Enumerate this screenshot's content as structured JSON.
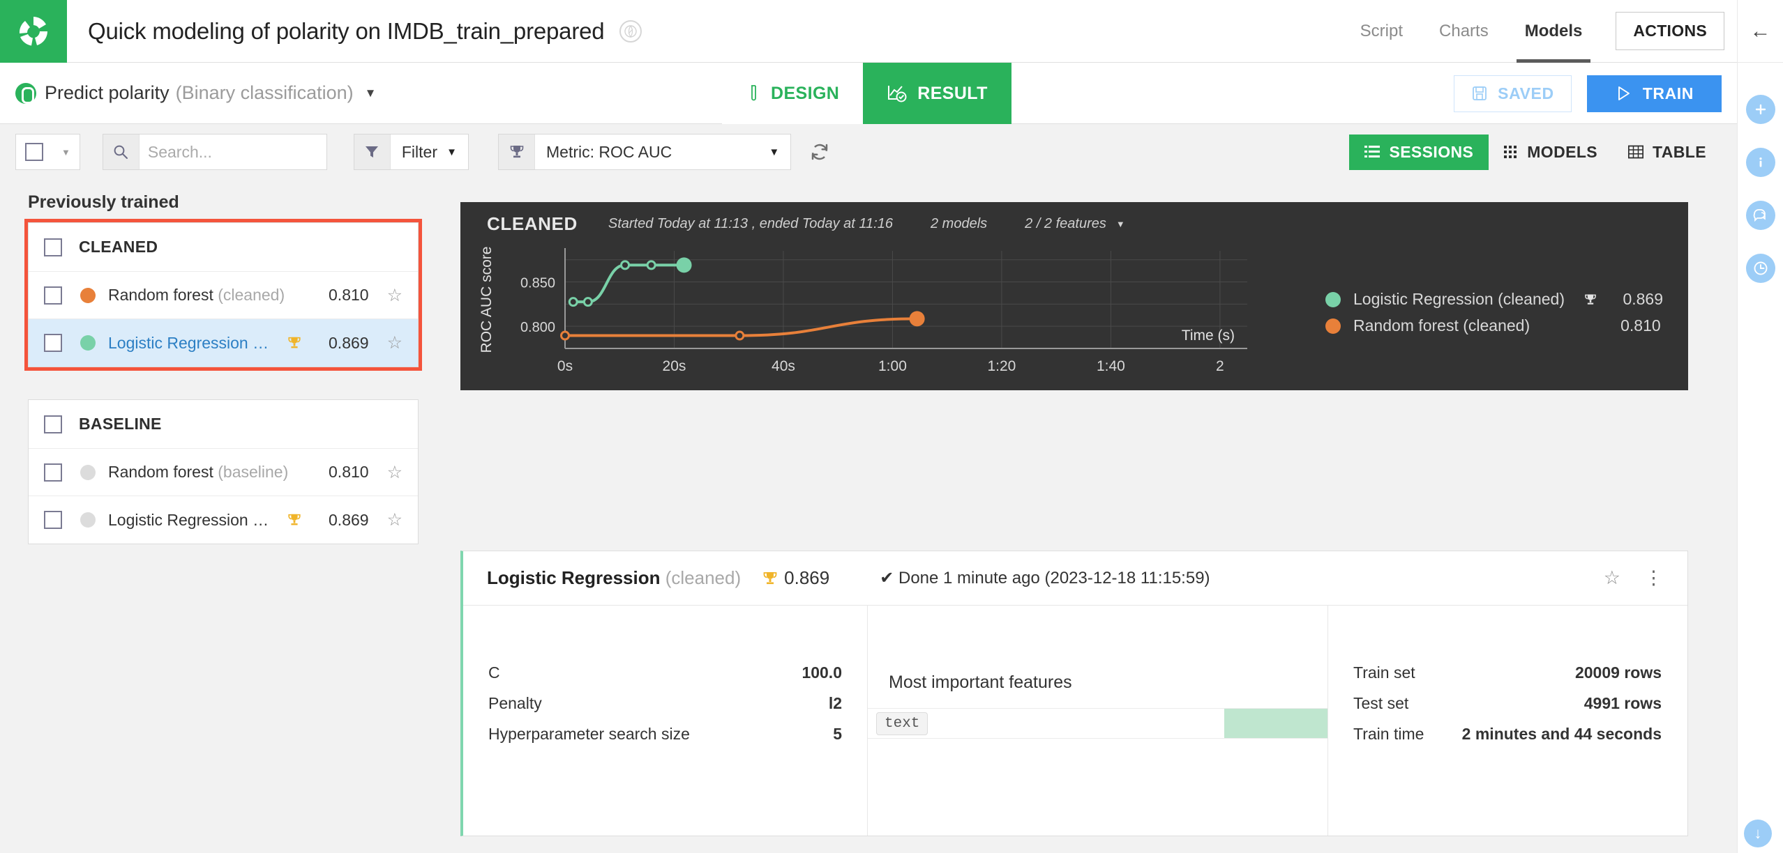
{
  "header": {
    "logo": "dataiku-logo",
    "title": "Quick modeling of polarity on IMDB_train_prepared",
    "title_badge_icon": "lab-circle-icon",
    "nav": [
      {
        "label": "Script",
        "active": false
      },
      {
        "label": "Charts",
        "active": false
      },
      {
        "label": "Models",
        "active": true
      }
    ],
    "actions_label": "ACTIONS",
    "back_icon": "arrow-left-icon"
  },
  "rail": {
    "icons": [
      "plus-icon",
      "info-icon",
      "chat-icon",
      "clock-icon"
    ]
  },
  "subbar": {
    "model_icon": "python-icon",
    "model_name": "Predict polarity",
    "model_kind": "(Binary classification)",
    "caret": "▼",
    "tabs": [
      {
        "label": "DESIGN",
        "icon": "test-tube-icon",
        "active": false
      },
      {
        "label": "RESULT",
        "icon": "chart-check-icon",
        "active": true
      }
    ],
    "saved_label": "SAVED",
    "saved_icon": "floppy-disk-icon",
    "train_label": "TRAIN",
    "train_icon": "play-icon"
  },
  "toolbar": {
    "select_all_icon": "checkbox-icon",
    "search_placeholder": "Search...",
    "search_value": "",
    "search_icon": "search-icon",
    "filter_icon": "funnel-icon",
    "filter_label": "Filter",
    "metric_icon": "trophy-icon",
    "metric_label": "Metric: ROC AUC",
    "refresh_icon": "refresh-icon",
    "views": [
      {
        "label": "SESSIONS",
        "icon": "list-icon",
        "active": true
      },
      {
        "label": "MODELS",
        "icon": "grid-icon",
        "active": false
      },
      {
        "label": "TABLE",
        "icon": "table-icon",
        "active": false
      }
    ]
  },
  "sidebar": {
    "section_title": "Previously trained",
    "groups": [
      {
        "name": "CLEANED",
        "highlighted": true,
        "rows": [
          {
            "name": "Random forest",
            "suffix": "(cleaned)",
            "score": "0.810",
            "dot": "#e8803a",
            "trophy": false,
            "selected": false,
            "star_icon": "star-outline-icon"
          },
          {
            "name": "Logistic Regression …",
            "suffix": "",
            "score": "0.869",
            "dot": "#79d1a8",
            "trophy": true,
            "selected": true,
            "star_icon": "star-outline-icon"
          }
        ]
      },
      {
        "name": "BASELINE",
        "highlighted": false,
        "rows": [
          {
            "name": "Random forest",
            "suffix": "(baseline)",
            "score": "0.810",
            "dot": "#dcdcdc",
            "trophy": false,
            "selected": false,
            "star_icon": "star-outline-icon"
          },
          {
            "name": "Logistic Regression …",
            "suffix": "",
            "score": "0.869",
            "dot": "#dcdcdc",
            "trophy": true,
            "selected": false,
            "star_icon": "star-outline-icon"
          }
        ]
      }
    ]
  },
  "session_chart": {
    "title": "CLEANED",
    "timing": "Started Today at 11:13 , ended Today at 11:16",
    "models_count": "2 models",
    "features": "2 / 2 features",
    "features_caret": "▼"
  },
  "chart_data": {
    "type": "line",
    "title": "CLEANED",
    "xlabel": "Time (s)",
    "ylabel": "ROC AUC score",
    "xlim": [
      0,
      125
    ],
    "ylim": [
      0.775,
      0.885
    ],
    "xticks": [
      0,
      20,
      40,
      60,
      80,
      100,
      120
    ],
    "xticklabels": [
      "0s",
      "20s",
      "40s",
      "1:00",
      "1:20",
      "1:40",
      "2"
    ],
    "yticks": [
      0.8,
      0.85
    ],
    "yticklabels": [
      "0.800",
      "0.850"
    ],
    "grid": true,
    "legend_position": "right",
    "series": [
      {
        "name": "Logistic Regression (cleaned)",
        "color": "#79d1a8",
        "best": "0.869",
        "trophy": true,
        "points": [
          {
            "x": 1.5,
            "y": 0.8275,
            "filled": false
          },
          {
            "x": 4.2,
            "y": 0.8275,
            "filled": false
          },
          {
            "x": 11.0,
            "y": 0.869,
            "filled": false
          },
          {
            "x": 15.8,
            "y": 0.869,
            "filled": false
          },
          {
            "x": 21.8,
            "y": 0.869,
            "filled": true
          }
        ]
      },
      {
        "name": "Random forest (cleaned)",
        "color": "#e8803a",
        "best": "0.810",
        "trophy": false,
        "points": [
          {
            "x": 0.0,
            "y": 0.7895,
            "filled": false
          },
          {
            "x": 32.0,
            "y": 0.7895,
            "filled": false
          },
          {
            "x": 64.5,
            "y": 0.8085,
            "filled": true
          }
        ]
      }
    ]
  },
  "model_card": {
    "name": "Logistic Regression",
    "suffix": "(cleaned)",
    "trophy_icon": "trophy-icon",
    "score": "0.869",
    "status_icon": "check-icon",
    "status": "Done 1 minute ago (2023-12-18 11:15:59)",
    "star_icon": "star-outline-icon",
    "menu_icon": "kebab-menu-icon",
    "hyperparameters": [
      {
        "key": "C",
        "value": "100.0"
      },
      {
        "key": "Penalty",
        "value": "l2"
      },
      {
        "key": "Hyperparameter search size",
        "value": "5"
      }
    ],
    "features_title": "Most important features",
    "features": [
      {
        "label": "text",
        "weight": 100
      }
    ],
    "stats": [
      {
        "key": "Train set",
        "value": "20009 rows"
      },
      {
        "key": "Test set",
        "value": "4991 rows"
      },
      {
        "key": "Train time",
        "value": "2 minutes and 44 seconds"
      }
    ]
  },
  "colors": {
    "brand_green": "#2ab25b",
    "accent_blue": "#3b93f0",
    "highlight_red": "#f4543c",
    "series_green": "#79d1a8",
    "series_orange": "#e8803a",
    "chart_bg": "#333333"
  }
}
